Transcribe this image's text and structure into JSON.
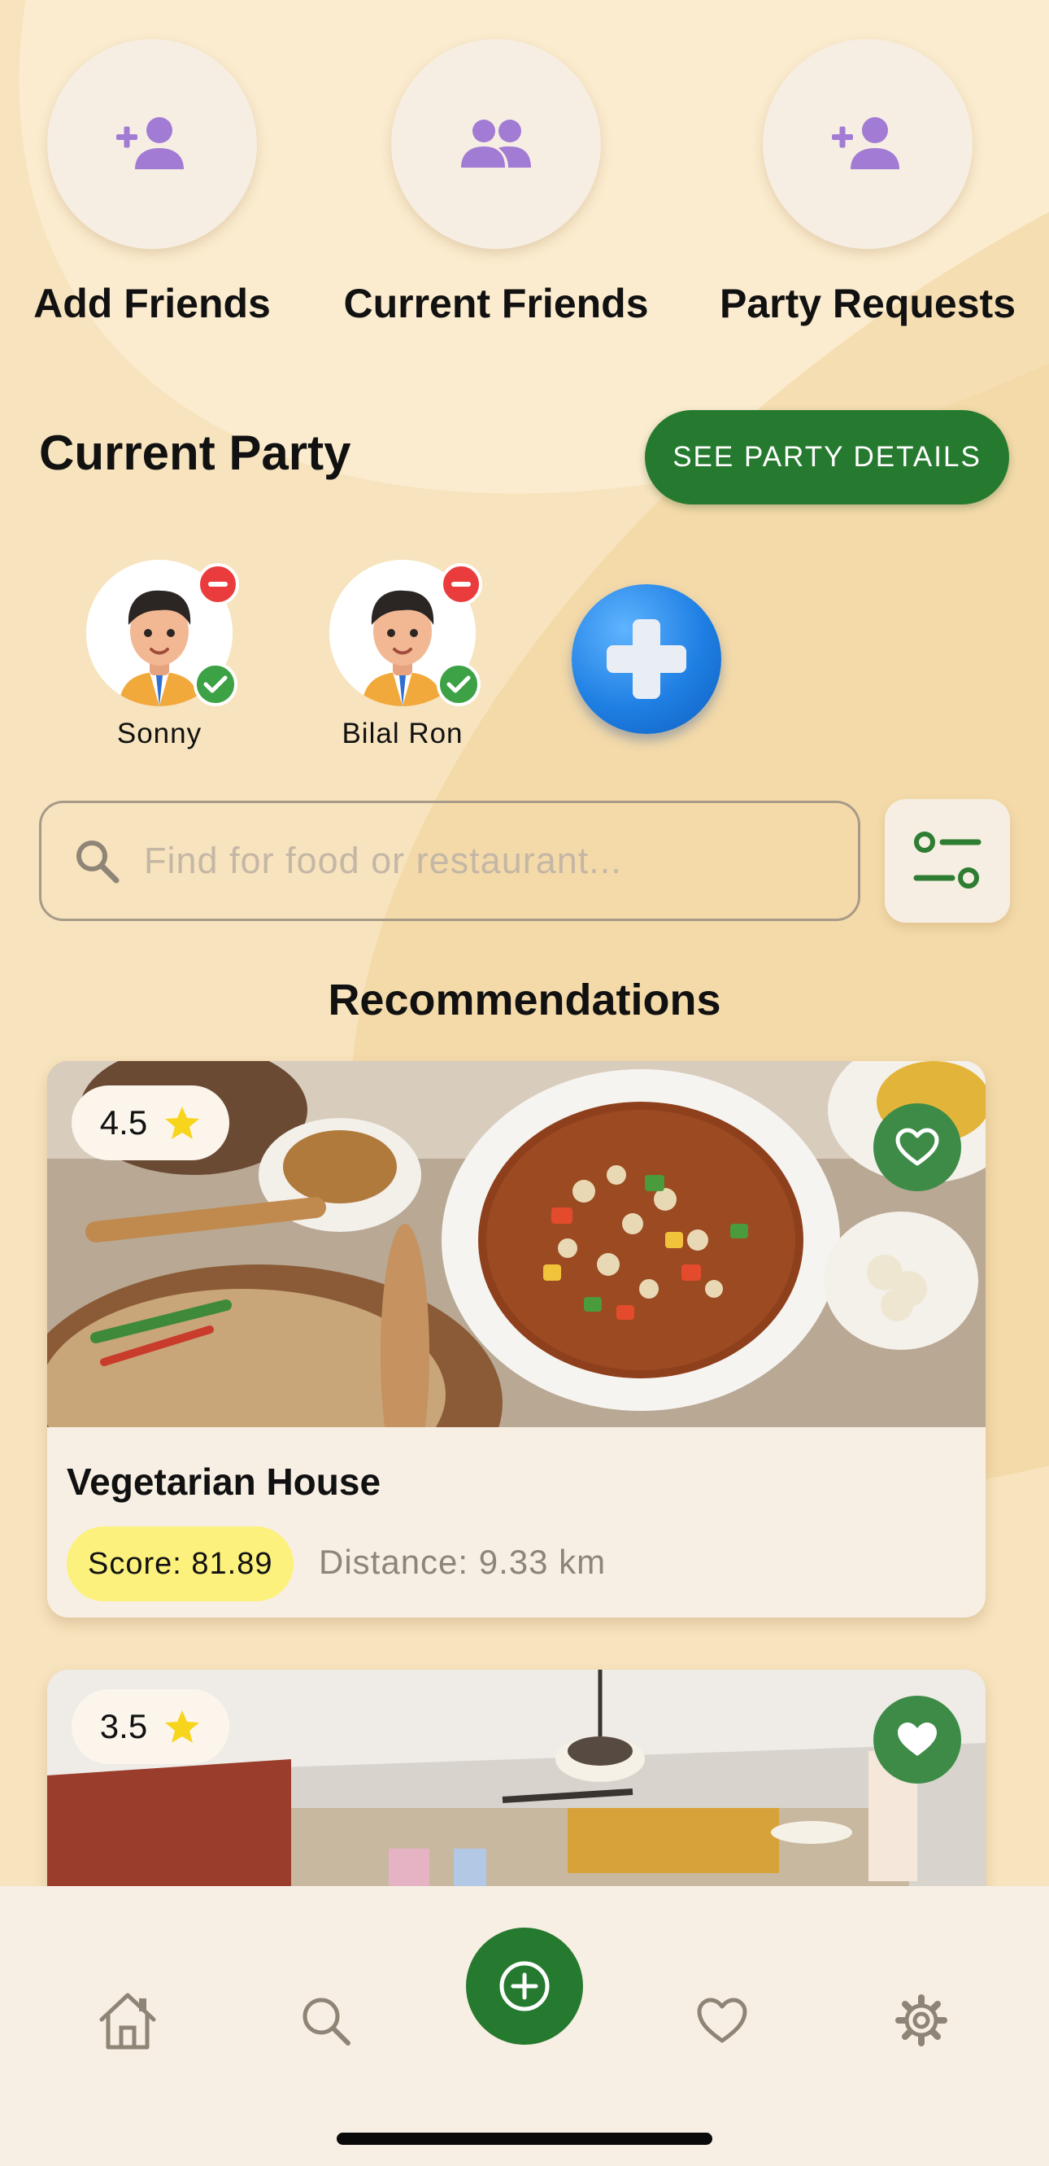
{
  "top_actions": [
    {
      "label": "Add Friends",
      "icon": "add-person-icon"
    },
    {
      "label": "Current Friends",
      "icon": "group-icon"
    },
    {
      "label": "Party Requests",
      "icon": "add-person-icon"
    }
  ],
  "party": {
    "title": "Current Party",
    "details_button": "SEE PARTY DETAILS",
    "members": [
      {
        "name": "Sonny",
        "avatar": "avatar-icon",
        "status": "accepted"
      },
      {
        "name": "Bilal Ron",
        "avatar": "avatar-icon",
        "status": "accepted"
      }
    ],
    "add_member_icon": "plus-icon"
  },
  "search": {
    "placeholder": "Find for food or restaurant...",
    "icon": "search-icon",
    "filter_icon": "filter-icon"
  },
  "recommendations": {
    "title": "Recommendations",
    "cards": [
      {
        "name": "Vegetarian House",
        "rating": "4.5",
        "score": "Score: 81.89",
        "distance": "Distance: 9.33 km",
        "favorited": false
      },
      {
        "name": "",
        "rating": "3.5",
        "favorited": true
      }
    ]
  },
  "bottom_nav": {
    "items": [
      "home-icon",
      "search-icon",
      "add-circle-icon",
      "heart-icon",
      "gear-icon"
    ],
    "active_color": "#267a2f"
  },
  "colors": {
    "accent_green": "#267a2f",
    "icon_purple": "#a27bd4",
    "background": "#f7e3bd",
    "star_yellow": "#f7d51d",
    "score_yellow": "#fbf17c",
    "remove_red": "#ea3c3c"
  }
}
